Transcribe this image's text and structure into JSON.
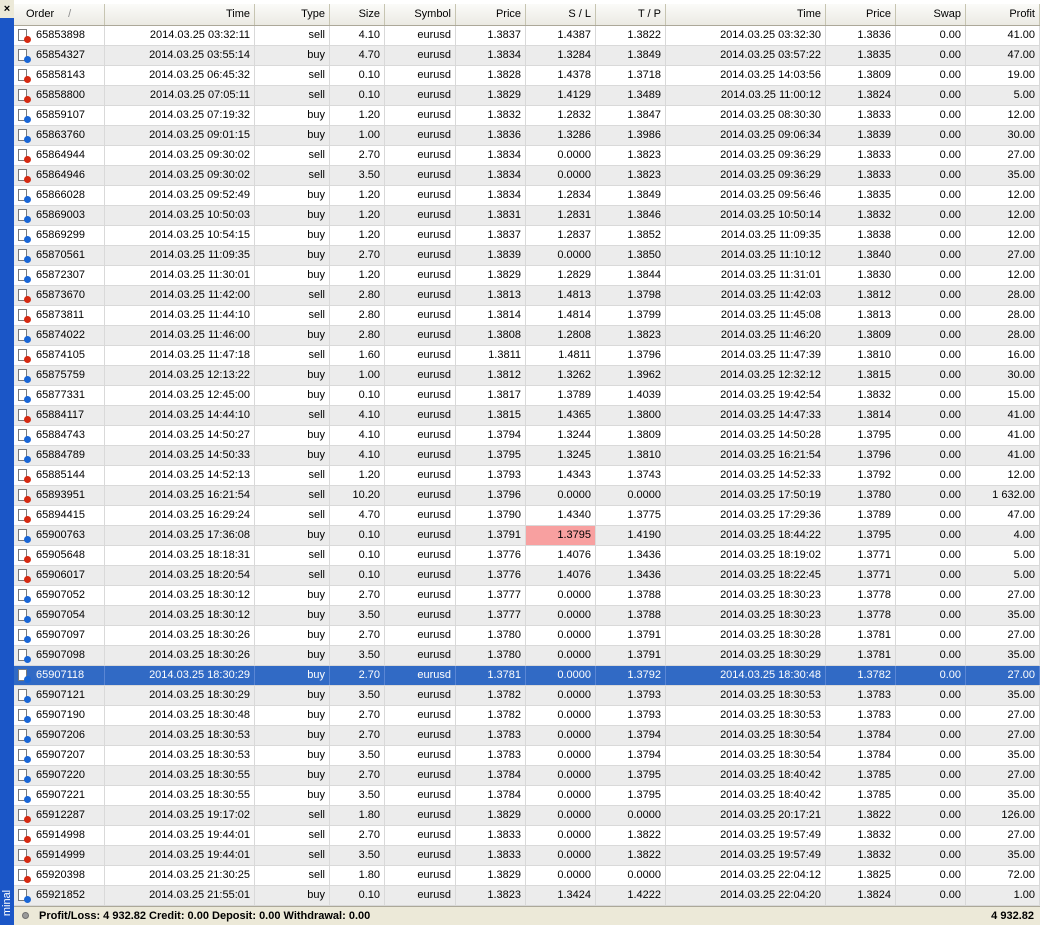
{
  "window": {
    "close_label": "×",
    "side_tab_label": "minal"
  },
  "table": {
    "sort_indicator": "/",
    "columns": [
      "Order",
      "Time",
      "Type",
      "Size",
      "Symbol",
      "Price",
      "S / L",
      "T / P",
      "Time",
      "Price",
      "Swap",
      "Profit"
    ],
    "rows": [
      [
        "65853898",
        "2014.03.25 03:32:11",
        "sell",
        "4.10",
        "eurusd",
        "1.3837",
        "1.4387",
        "1.3822",
        "2014.03.25 03:32:30",
        "1.3836",
        "0.00",
        "41.00"
      ],
      [
        "65854327",
        "2014.03.25 03:55:14",
        "buy",
        "4.70",
        "eurusd",
        "1.3834",
        "1.3284",
        "1.3849",
        "2014.03.25 03:57:22",
        "1.3835",
        "0.00",
        "47.00"
      ],
      [
        "65858143",
        "2014.03.25 06:45:32",
        "sell",
        "0.10",
        "eurusd",
        "1.3828",
        "1.4378",
        "1.3718",
        "2014.03.25 14:03:56",
        "1.3809",
        "0.00",
        "19.00"
      ],
      [
        "65858800",
        "2014.03.25 07:05:11",
        "sell",
        "0.10",
        "eurusd",
        "1.3829",
        "1.4129",
        "1.3489",
        "2014.03.25 11:00:12",
        "1.3824",
        "0.00",
        "5.00"
      ],
      [
        "65859107",
        "2014.03.25 07:19:32",
        "buy",
        "1.20",
        "eurusd",
        "1.3832",
        "1.2832",
        "1.3847",
        "2014.03.25 08:30:30",
        "1.3833",
        "0.00",
        "12.00"
      ],
      [
        "65863760",
        "2014.03.25 09:01:15",
        "buy",
        "1.00",
        "eurusd",
        "1.3836",
        "1.3286",
        "1.3986",
        "2014.03.25 09:06:34",
        "1.3839",
        "0.00",
        "30.00"
      ],
      [
        "65864944",
        "2014.03.25 09:30:02",
        "sell",
        "2.70",
        "eurusd",
        "1.3834",
        "0.0000",
        "1.3823",
        "2014.03.25 09:36:29",
        "1.3833",
        "0.00",
        "27.00"
      ],
      [
        "65864946",
        "2014.03.25 09:30:02",
        "sell",
        "3.50",
        "eurusd",
        "1.3834",
        "0.0000",
        "1.3823",
        "2014.03.25 09:36:29",
        "1.3833",
        "0.00",
        "35.00"
      ],
      [
        "65866028",
        "2014.03.25 09:52:49",
        "buy",
        "1.20",
        "eurusd",
        "1.3834",
        "1.2834",
        "1.3849",
        "2014.03.25 09:56:46",
        "1.3835",
        "0.00",
        "12.00"
      ],
      [
        "65869003",
        "2014.03.25 10:50:03",
        "buy",
        "1.20",
        "eurusd",
        "1.3831",
        "1.2831",
        "1.3846",
        "2014.03.25 10:50:14",
        "1.3832",
        "0.00",
        "12.00"
      ],
      [
        "65869299",
        "2014.03.25 10:54:15",
        "buy",
        "1.20",
        "eurusd",
        "1.3837",
        "1.2837",
        "1.3852",
        "2014.03.25 11:09:35",
        "1.3838",
        "0.00",
        "12.00"
      ],
      [
        "65870561",
        "2014.03.25 11:09:35",
        "buy",
        "2.70",
        "eurusd",
        "1.3839",
        "0.0000",
        "1.3850",
        "2014.03.25 11:10:12",
        "1.3840",
        "0.00",
        "27.00"
      ],
      [
        "65872307",
        "2014.03.25 11:30:01",
        "buy",
        "1.20",
        "eurusd",
        "1.3829",
        "1.2829",
        "1.3844",
        "2014.03.25 11:31:01",
        "1.3830",
        "0.00",
        "12.00"
      ],
      [
        "65873670",
        "2014.03.25 11:42:00",
        "sell",
        "2.80",
        "eurusd",
        "1.3813",
        "1.4813",
        "1.3798",
        "2014.03.25 11:42:03",
        "1.3812",
        "0.00",
        "28.00"
      ],
      [
        "65873811",
        "2014.03.25 11:44:10",
        "sell",
        "2.80",
        "eurusd",
        "1.3814",
        "1.4814",
        "1.3799",
        "2014.03.25 11:45:08",
        "1.3813",
        "0.00",
        "28.00"
      ],
      [
        "65874022",
        "2014.03.25 11:46:00",
        "buy",
        "2.80",
        "eurusd",
        "1.3808",
        "1.2808",
        "1.3823",
        "2014.03.25 11:46:20",
        "1.3809",
        "0.00",
        "28.00"
      ],
      [
        "65874105",
        "2014.03.25 11:47:18",
        "sell",
        "1.60",
        "eurusd",
        "1.3811",
        "1.4811",
        "1.3796",
        "2014.03.25 11:47:39",
        "1.3810",
        "0.00",
        "16.00"
      ],
      [
        "65875759",
        "2014.03.25 12:13:22",
        "buy",
        "1.00",
        "eurusd",
        "1.3812",
        "1.3262",
        "1.3962",
        "2014.03.25 12:32:12",
        "1.3815",
        "0.00",
        "30.00"
      ],
      [
        "65877331",
        "2014.03.25 12:45:00",
        "buy",
        "0.10",
        "eurusd",
        "1.3817",
        "1.3789",
        "1.4039",
        "2014.03.25 19:42:54",
        "1.3832",
        "0.00",
        "15.00"
      ],
      [
        "65884117",
        "2014.03.25 14:44:10",
        "sell",
        "4.10",
        "eurusd",
        "1.3815",
        "1.4365",
        "1.3800",
        "2014.03.25 14:47:33",
        "1.3814",
        "0.00",
        "41.00"
      ],
      [
        "65884743",
        "2014.03.25 14:50:27",
        "buy",
        "4.10",
        "eurusd",
        "1.3794",
        "1.3244",
        "1.3809",
        "2014.03.25 14:50:28",
        "1.3795",
        "0.00",
        "41.00"
      ],
      [
        "65884789",
        "2014.03.25 14:50:33",
        "buy",
        "4.10",
        "eurusd",
        "1.3795",
        "1.3245",
        "1.3810",
        "2014.03.25 16:21:54",
        "1.3796",
        "0.00",
        "41.00"
      ],
      [
        "65885144",
        "2014.03.25 14:52:13",
        "sell",
        "1.20",
        "eurusd",
        "1.3793",
        "1.4343",
        "1.3743",
        "2014.03.25 14:52:33",
        "1.3792",
        "0.00",
        "12.00"
      ],
      [
        "65893951",
        "2014.03.25 16:21:54",
        "sell",
        "10.20",
        "eurusd",
        "1.3796",
        "0.0000",
        "0.0000",
        "2014.03.25 17:50:19",
        "1.3780",
        "0.00",
        "1 632.00"
      ],
      [
        "65894415",
        "2014.03.25 16:29:24",
        "sell",
        "4.70",
        "eurusd",
        "1.3790",
        "1.4340",
        "1.3775",
        "2014.03.25 17:29:36",
        "1.3789",
        "0.00",
        "47.00"
      ],
      [
        "65900763",
        "2014.03.25 17:36:08",
        "buy",
        "0.10",
        "eurusd",
        "1.3791",
        "1.3795",
        "1.4190",
        "2014.03.25 18:44:22",
        "1.3795",
        "0.00",
        "4.00"
      ],
      [
        "65905648",
        "2014.03.25 18:18:31",
        "sell",
        "0.10",
        "eurusd",
        "1.3776",
        "1.4076",
        "1.3436",
        "2014.03.25 18:19:02",
        "1.3771",
        "0.00",
        "5.00"
      ],
      [
        "65906017",
        "2014.03.25 18:20:54",
        "sell",
        "0.10",
        "eurusd",
        "1.3776",
        "1.4076",
        "1.3436",
        "2014.03.25 18:22:45",
        "1.3771",
        "0.00",
        "5.00"
      ],
      [
        "65907052",
        "2014.03.25 18:30:12",
        "buy",
        "2.70",
        "eurusd",
        "1.3777",
        "0.0000",
        "1.3788",
        "2014.03.25 18:30:23",
        "1.3778",
        "0.00",
        "27.00"
      ],
      [
        "65907054",
        "2014.03.25 18:30:12",
        "buy",
        "3.50",
        "eurusd",
        "1.3777",
        "0.0000",
        "1.3788",
        "2014.03.25 18:30:23",
        "1.3778",
        "0.00",
        "35.00"
      ],
      [
        "65907097",
        "2014.03.25 18:30:26",
        "buy",
        "2.70",
        "eurusd",
        "1.3780",
        "0.0000",
        "1.3791",
        "2014.03.25 18:30:28",
        "1.3781",
        "0.00",
        "27.00"
      ],
      [
        "65907098",
        "2014.03.25 18:30:26",
        "buy",
        "3.50",
        "eurusd",
        "1.3780",
        "0.0000",
        "1.3791",
        "2014.03.25 18:30:29",
        "1.3781",
        "0.00",
        "35.00"
      ],
      [
        "65907118",
        "2014.03.25 18:30:29",
        "buy",
        "2.70",
        "eurusd",
        "1.3781",
        "0.0000",
        "1.3792",
        "2014.03.25 18:30:48",
        "1.3782",
        "0.00",
        "27.00"
      ],
      [
        "65907121",
        "2014.03.25 18:30:29",
        "buy",
        "3.50",
        "eurusd",
        "1.3782",
        "0.0000",
        "1.3793",
        "2014.03.25 18:30:53",
        "1.3783",
        "0.00",
        "35.00"
      ],
      [
        "65907190",
        "2014.03.25 18:30:48",
        "buy",
        "2.70",
        "eurusd",
        "1.3782",
        "0.0000",
        "1.3793",
        "2014.03.25 18:30:53",
        "1.3783",
        "0.00",
        "27.00"
      ],
      [
        "65907206",
        "2014.03.25 18:30:53",
        "buy",
        "2.70",
        "eurusd",
        "1.3783",
        "0.0000",
        "1.3794",
        "2014.03.25 18:30:54",
        "1.3784",
        "0.00",
        "27.00"
      ],
      [
        "65907207",
        "2014.03.25 18:30:53",
        "buy",
        "3.50",
        "eurusd",
        "1.3783",
        "0.0000",
        "1.3794",
        "2014.03.25 18:30:54",
        "1.3784",
        "0.00",
        "35.00"
      ],
      [
        "65907220",
        "2014.03.25 18:30:55",
        "buy",
        "2.70",
        "eurusd",
        "1.3784",
        "0.0000",
        "1.3795",
        "2014.03.25 18:40:42",
        "1.3785",
        "0.00",
        "27.00"
      ],
      [
        "65907221",
        "2014.03.25 18:30:55",
        "buy",
        "3.50",
        "eurusd",
        "1.3784",
        "0.0000",
        "1.3795",
        "2014.03.25 18:40:42",
        "1.3785",
        "0.00",
        "35.00"
      ],
      [
        "65912287",
        "2014.03.25 19:17:02",
        "sell",
        "1.80",
        "eurusd",
        "1.3829",
        "0.0000",
        "0.0000",
        "2014.03.25 20:17:21",
        "1.3822",
        "0.00",
        "126.00"
      ],
      [
        "65914998",
        "2014.03.25 19:44:01",
        "sell",
        "2.70",
        "eurusd",
        "1.3833",
        "0.0000",
        "1.3822",
        "2014.03.25 19:57:49",
        "1.3832",
        "0.00",
        "27.00"
      ],
      [
        "65914999",
        "2014.03.25 19:44:01",
        "sell",
        "3.50",
        "eurusd",
        "1.3833",
        "0.0000",
        "1.3822",
        "2014.03.25 19:57:49",
        "1.3832",
        "0.00",
        "35.00"
      ],
      [
        "65920398",
        "2014.03.25 21:30:25",
        "sell",
        "1.80",
        "eurusd",
        "1.3829",
        "0.0000",
        "0.0000",
        "2014.03.25 22:04:12",
        "1.3825",
        "0.00",
        "72.00"
      ],
      [
        "65921852",
        "2014.03.25 21:55:01",
        "buy",
        "0.10",
        "eurusd",
        "1.3823",
        "1.3424",
        "1.4222",
        "2014.03.25 22:04:20",
        "1.3824",
        "0.00",
        "1.00"
      ]
    ],
    "selected_order": "65907118",
    "highlighted_sl_order": "65900763",
    "highlight_color": "#f8a0a0",
    "selection_color": "#316ac5"
  },
  "status": {
    "summary": "Profit/Loss: 4 932.82  Credit: 0.00  Deposit: 0.00  Withdrawal: 0.00",
    "total": "4 932.82"
  }
}
